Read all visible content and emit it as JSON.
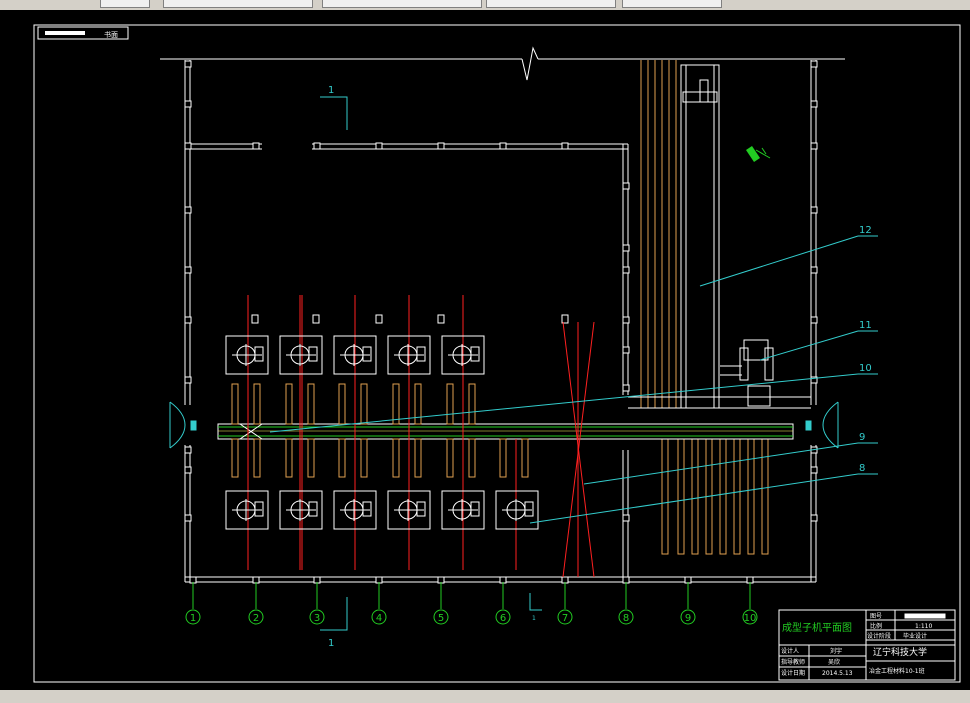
{
  "tabs": [
    {
      "label": "",
      "active": false
    },
    {
      "label": "",
      "active": false
    },
    {
      "label": "",
      "active": false
    },
    {
      "label": "",
      "active": false
    },
    {
      "label": "",
      "active": false
    }
  ],
  "frame_label": "书面",
  "section_marker": "1",
  "section_tick_label": "1",
  "axis_labels": [
    "1",
    "2",
    "3",
    "4",
    "5",
    "6",
    "7",
    "8",
    "9",
    "10"
  ],
  "callouts": [
    "12",
    "11",
    "10",
    "9",
    "8"
  ],
  "title_block": {
    "drawing_title": "成型子机平面图",
    "drawing_no_label": "图号",
    "scale_label": "比例",
    "scale_value": "1:110",
    "stage_label": "设计阶段",
    "stage_value": "毕业设计",
    "university": "辽宁科技大学",
    "designer_label": "设计人",
    "designer_value": "刘宇",
    "advisor_label": "指导教师",
    "advisor_value": "吴欣",
    "date_label": "设计日期",
    "date_value": "2014.5.13",
    "class_value": "冶金工程材料10-1班"
  },
  "colors": {
    "background": "#000000",
    "wall": "#ffffff",
    "axis": "#22cc22",
    "callout": "#33cccc",
    "red_line": "#ff2020",
    "orange": "#e0a050",
    "title_text": "#22cc22"
  }
}
